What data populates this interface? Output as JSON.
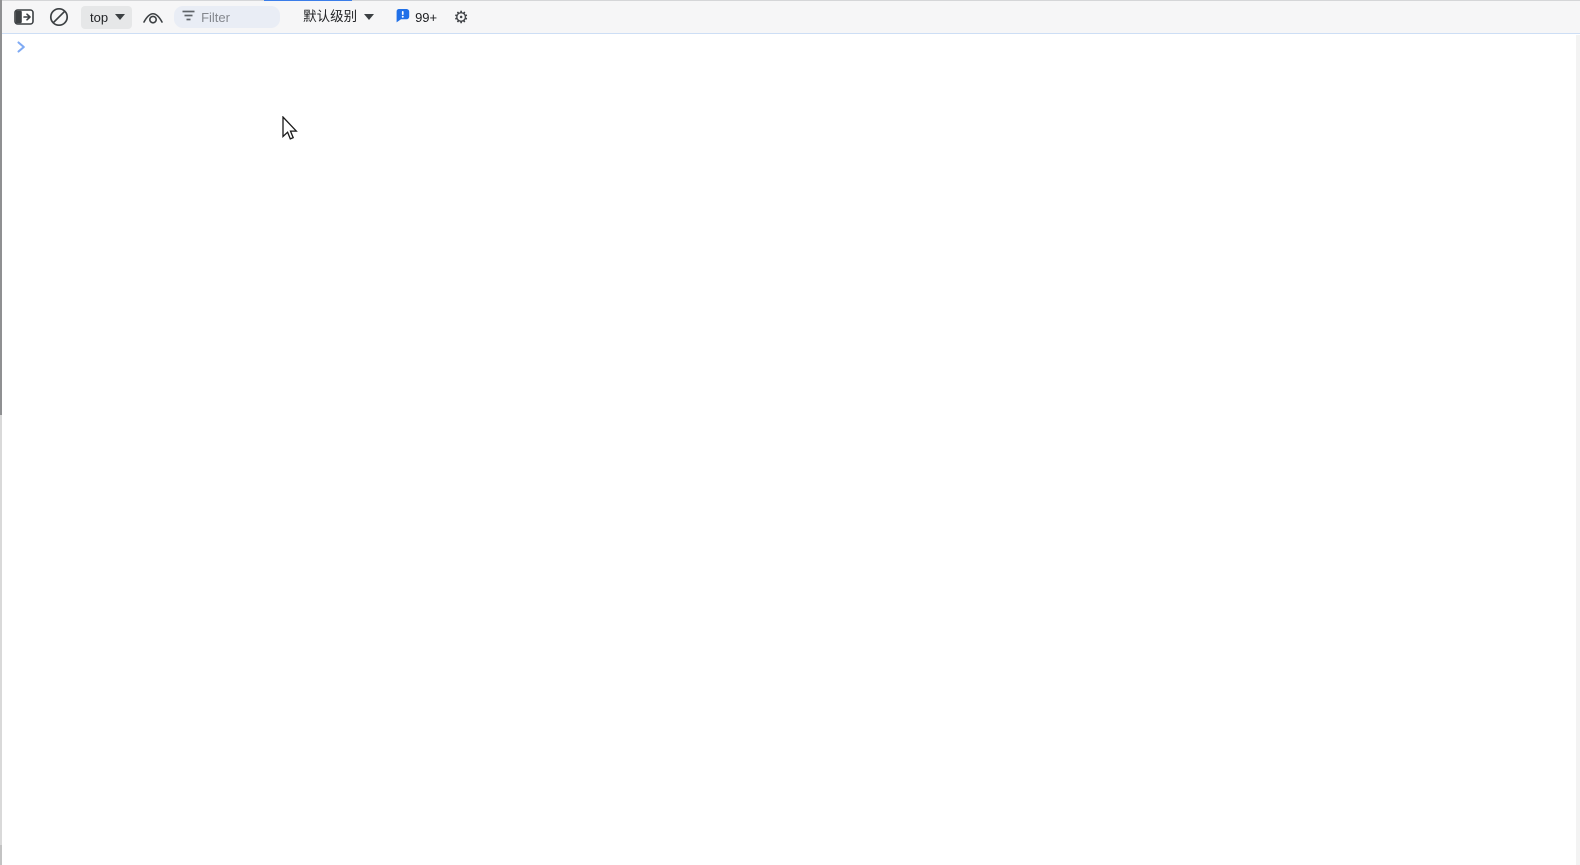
{
  "toolbar": {
    "context_selector": {
      "value": "top"
    },
    "filter_input": {
      "placeholder": "Filter",
      "value": ""
    },
    "log_level_dropdown": {
      "value": "默认级别"
    },
    "issues_badge": {
      "count": "99+"
    },
    "gear_glyph": "⚙"
  },
  "console": {
    "prompt_symbol": ">",
    "messages": []
  },
  "icons": {
    "sidebar_toggle": "show-console-sidebar-icon",
    "clear_console": "ban-circle-icon",
    "live_expression": "eye-icon",
    "filter": "filter-lines-icon",
    "issues": "issues-bubble-icon",
    "settings": "gear-icon",
    "prompt": "chevron-right-icon",
    "dropdown": "chevron-down-icon"
  },
  "colors": {
    "active_tab_indicator": "#3b7de9",
    "toolbar_background": "#f6f6f7",
    "toolbar_bottom_border": "#cddef5",
    "context_button_background": "#e6e7e8",
    "filter_field_background": "#e9edf5",
    "icon_gray": "#3c4043",
    "issues_blue": "#2070e8",
    "prompt_chevron_blue": "#7faaf4",
    "window_edge_dark": "#8f9092",
    "window_edge_light": "#d9d9d9"
  }
}
